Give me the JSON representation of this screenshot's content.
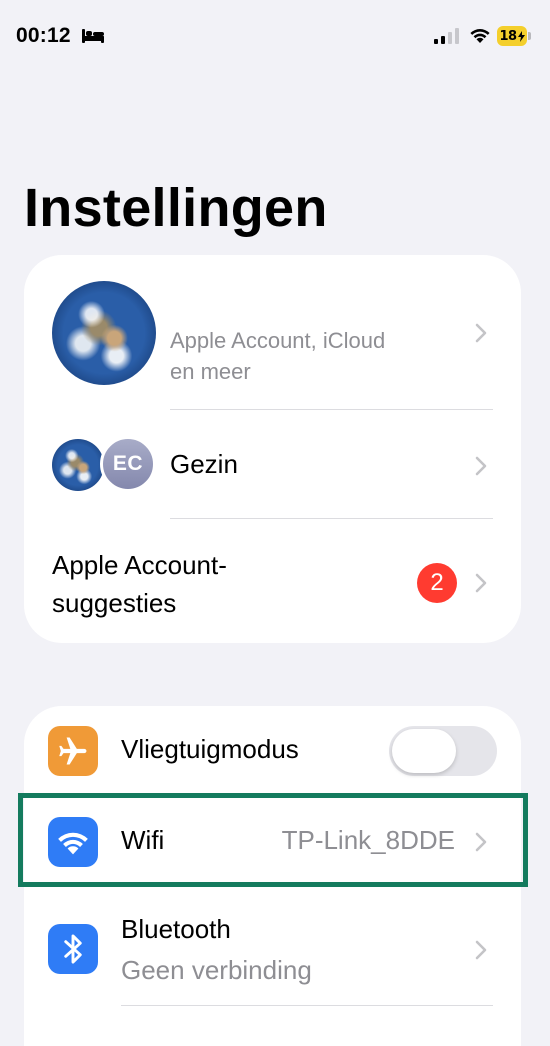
{
  "status_bar": {
    "time": "00:12",
    "battery": "18",
    "colors": {
      "battery": "#f4cf2c"
    }
  },
  "page": {
    "title": "Instellingen"
  },
  "account_card": {
    "profile": {
      "subtitle_line1": "Apple Account, iCloud",
      "subtitle_line2": "en meer"
    },
    "family": {
      "initials": "EC",
      "label": "Gezin"
    },
    "suggestions": {
      "label_line1": "Apple Account-",
      "label_line2": "suggesties",
      "badge_count": "2"
    }
  },
  "settings_card": {
    "airplane": {
      "label": "Vliegtuigmodus",
      "toggle_on": false,
      "icon": "airplane-icon"
    },
    "wifi": {
      "label": "Wifi",
      "value": "TP-Link_8DDE",
      "icon": "wifi-icon",
      "highlighted": true
    },
    "bluetooth": {
      "label": "Bluetooth",
      "value": "Geen verbinding",
      "icon": "bluetooth-icon"
    }
  },
  "colors": {
    "background": "#f2f2f7",
    "badge": "#ff3b30",
    "airplane_icon": "#f09a37",
    "blue_icon": "#2f7cf6",
    "highlight": "#147b5e"
  }
}
